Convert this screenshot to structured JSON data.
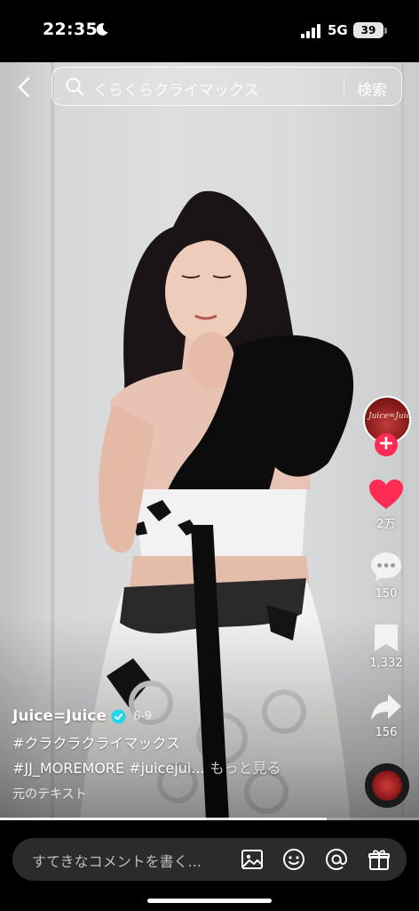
{
  "status_bar": {
    "time": "22:35",
    "network": "5G",
    "battery": "39"
  },
  "search": {
    "placeholder": "くらくらクライマックス",
    "button_label": "検索"
  },
  "rail": {
    "likes": "2万",
    "comments": "150",
    "saves": "1,332",
    "shares": "156",
    "avatar_logo_text": "Juice=Juice",
    "follow_symbol": "+"
  },
  "caption": {
    "author": "Juice=Juice",
    "time_ago": "6-9",
    "line1": "#クラクラクライマックス",
    "line2": "#JJ_MOREMORE #juicejui...",
    "more": "もっと見る",
    "translate": "元のテキスト"
  },
  "progress": {
    "fraction": 0.78
  },
  "comment_bar": {
    "placeholder": "すてきなコメントを書く..."
  },
  "icons": [
    "back-icon",
    "search-icon",
    "moon-icon",
    "signal-icon",
    "heart-icon",
    "comment-icon",
    "bookmark-icon",
    "share-icon",
    "verified-icon",
    "image-icon",
    "emoji-icon",
    "mention-icon",
    "gift-icon"
  ],
  "colors": {
    "like_red": "#fe2c55",
    "verified_blue": "#20d5ec",
    "bar_bg": "#000000",
    "comment_field": "#2b2b2b"
  }
}
